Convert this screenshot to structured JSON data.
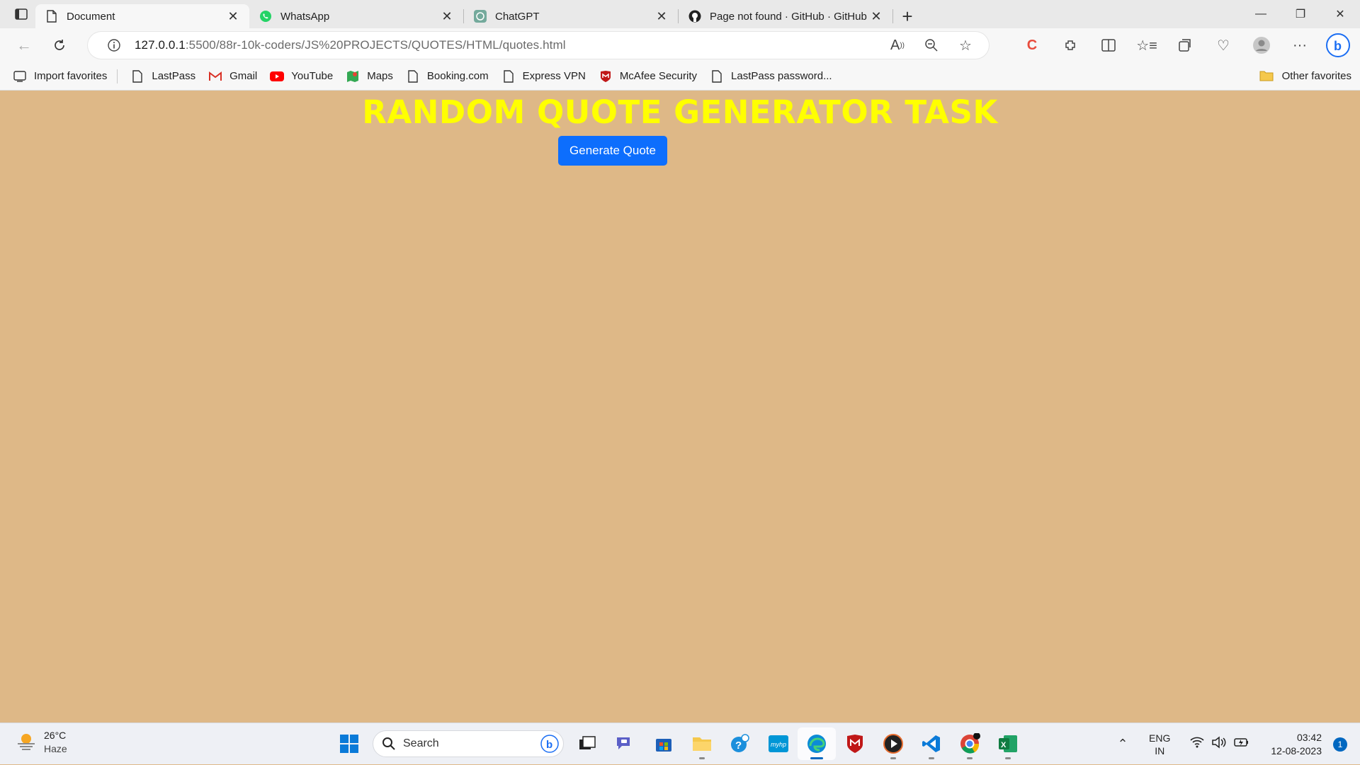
{
  "tabs": [
    {
      "title": "Document",
      "icon": "document-icon",
      "active": true
    },
    {
      "title": "WhatsApp",
      "icon": "whatsapp-icon",
      "active": false
    },
    {
      "title": "ChatGPT",
      "icon": "chatgpt-icon",
      "active": false
    },
    {
      "title": "Page not found · GitHub · GitHub",
      "icon": "github-icon",
      "active": false
    }
  ],
  "address": {
    "host": "127.0.0.1",
    "path": ":5500/88r-10k-coders/JS%20PROJECTS/QUOTES/HTML/quotes.html"
  },
  "favorites": [
    {
      "label": "Import favorites",
      "icon": "import-icon"
    },
    {
      "label": "LastPass",
      "icon": "page-icon"
    },
    {
      "label": "Gmail",
      "icon": "gmail-icon"
    },
    {
      "label": "YouTube",
      "icon": "youtube-icon"
    },
    {
      "label": "Maps",
      "icon": "maps-icon"
    },
    {
      "label": "Booking.com",
      "icon": "page-icon"
    },
    {
      "label": "Express VPN",
      "icon": "page-icon"
    },
    {
      "label": "McAfee Security",
      "icon": "mcafee-icon"
    },
    {
      "label": "LastPass password...",
      "icon": "page-icon"
    }
  ],
  "other_favorites": "Other favorites",
  "page": {
    "title": "RANDOM QUOTE GENERATOR TASK",
    "button_label": "Generate Quote"
  },
  "taskbar": {
    "weather_temp": "26°C",
    "weather_desc": "Haze",
    "search_label": "Search",
    "lang_top": "ENG",
    "lang_bottom": "IN",
    "time": "03:42",
    "date": "12-08-2023",
    "notification_count": "1"
  },
  "colors": {
    "page_bg": "#deb887",
    "title": "#ffff00",
    "button": "#0d6efd"
  }
}
